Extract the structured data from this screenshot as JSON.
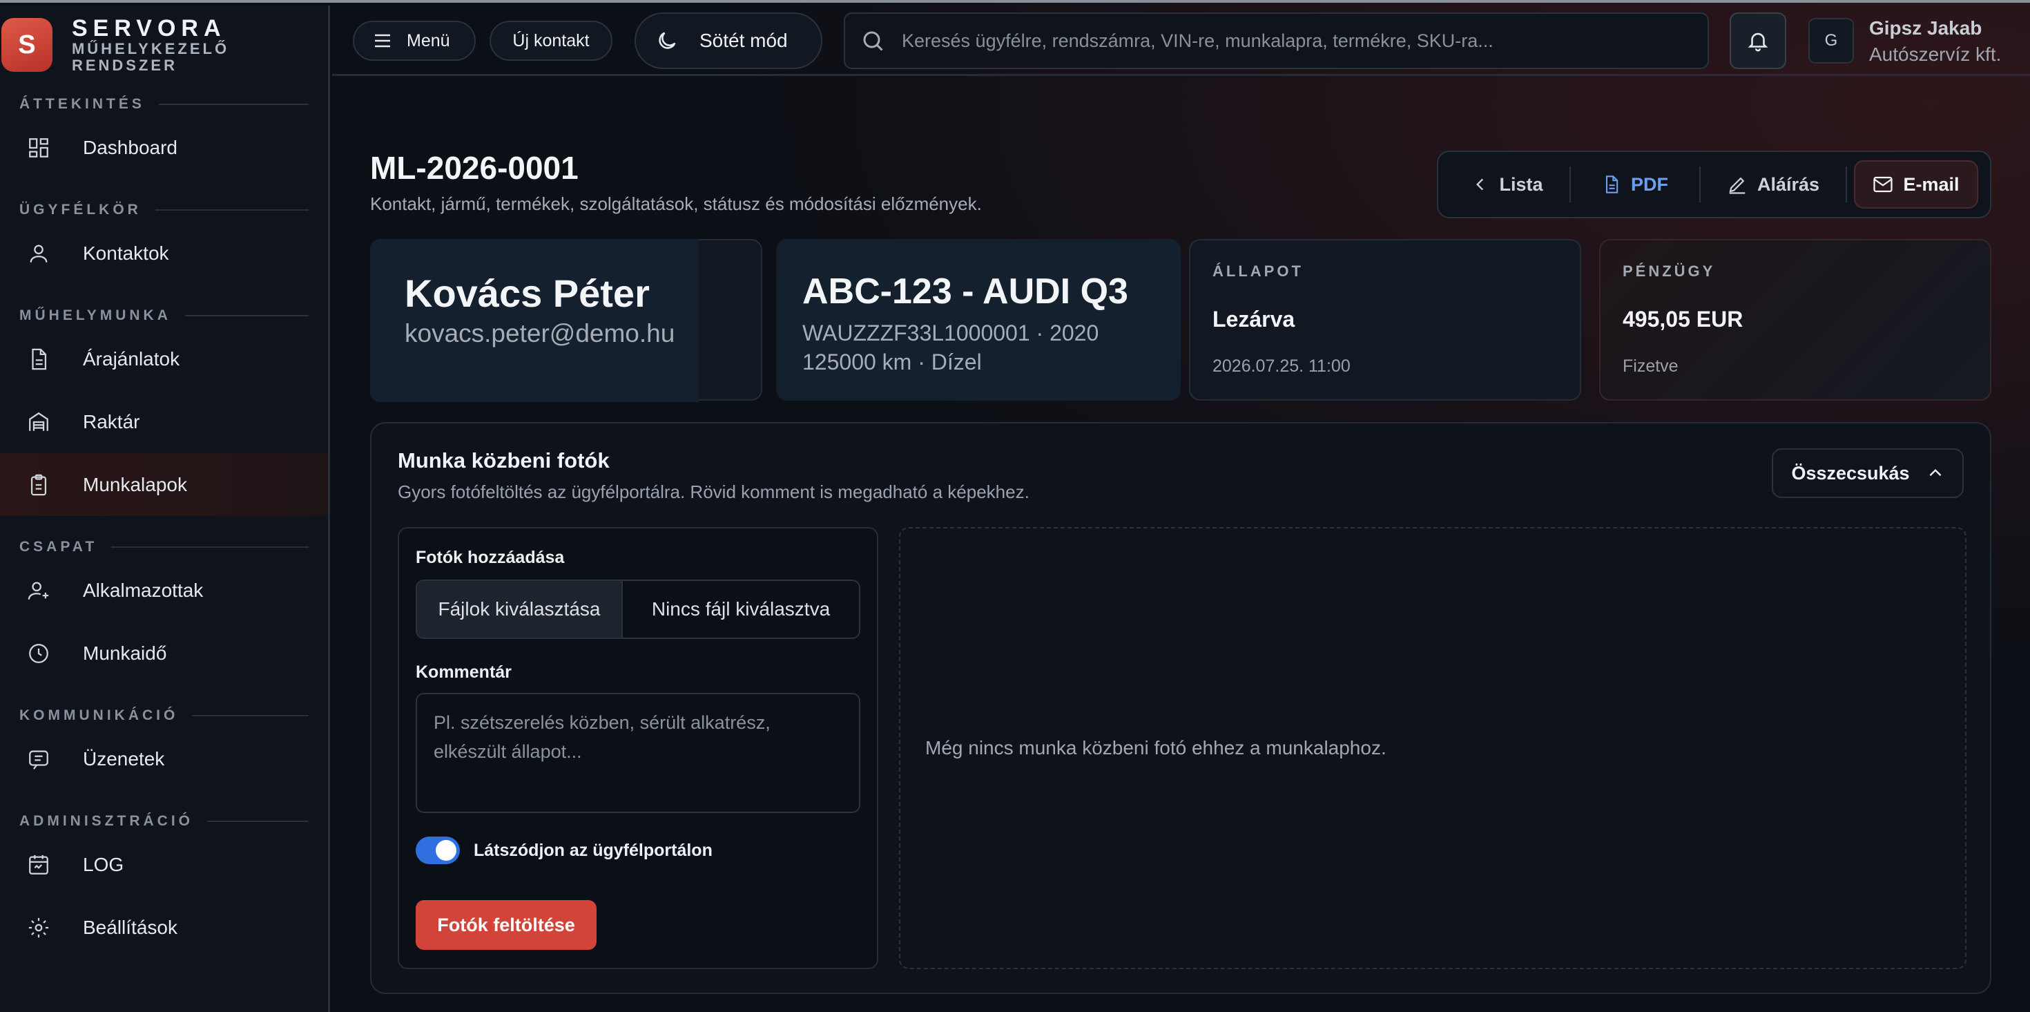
{
  "brand": {
    "logo_letter": "S",
    "name": "SERVORA",
    "subtitle": "MŰHELYKEZELŐ RENDSZER"
  },
  "sidebar": {
    "sections": [
      {
        "title": "ÁTTEKINTÉS",
        "items": [
          {
            "label": "Dashboard",
            "icon": "dashboard-icon"
          }
        ]
      },
      {
        "title": "ÜGYFÉLKÖR",
        "items": [
          {
            "label": "Kontaktok",
            "icon": "user-icon"
          }
        ]
      },
      {
        "title": "MŰHELYMUNKA",
        "items": [
          {
            "label": "Árajánlatok",
            "icon": "document-icon"
          },
          {
            "label": "Raktár",
            "icon": "warehouse-icon"
          },
          {
            "label": "Munkalapok",
            "icon": "clipboard-icon",
            "active": true
          }
        ]
      },
      {
        "title": "CSAPAT",
        "items": [
          {
            "label": "Alkalmazottak",
            "icon": "user-plus-icon"
          },
          {
            "label": "Munkaidő",
            "icon": "clock-icon"
          }
        ]
      },
      {
        "title": "KOMMUNIKÁCIÓ",
        "items": [
          {
            "label": "Üzenetek",
            "icon": "message-icon"
          }
        ]
      },
      {
        "title": "ADMINISZTRÁCIÓ",
        "items": [
          {
            "label": "LOG",
            "icon": "log-icon"
          },
          {
            "label": "Beállítások",
            "icon": "gear-icon"
          }
        ]
      }
    ]
  },
  "topbar": {
    "menu_label": "Menü",
    "new_contact_label": "Új kontakt",
    "dark_mode_label": "Sötét mód",
    "search_placeholder": "Keresés ügyfélre, rendszámra, VIN-re, munkalapra, termékre, SKU-ra...",
    "avatar_letter": "G",
    "user_name": "Gipsz Jakab",
    "company": "Autószervíz kft."
  },
  "page": {
    "title": "ML-2026-0001",
    "subtitle": "Kontakt, jármű, termékek, szolgáltatások, státusz és módosítási előzmények."
  },
  "actions": {
    "list": "Lista",
    "pdf": "PDF",
    "sign": "Aláírás",
    "email": "E-mail"
  },
  "cards": {
    "contact": {
      "name": "Kovács Péter",
      "email": "kovacs.peter@demo.hu"
    },
    "vehicle": {
      "plate_model": "ABC-123 - AUDI Q3",
      "vin_year": "WAUZZZF33L1000001 · 2020",
      "km_fuel": "125000 km · Dízel"
    },
    "status": {
      "label": "ÁLLAPOT",
      "value": "Lezárva",
      "date": "2026.07.25. 11:00"
    },
    "finance": {
      "label": "PÉNZÜGY",
      "value": "495,05 EUR",
      "state": "Fizetve"
    }
  },
  "photos": {
    "title": "Munka közbeni fotók",
    "subtitle": "Gyors fotófeltöltés az ügyfélportálra. Rövid komment is megadható a képekhez.",
    "collapse_label": "Összecsukás",
    "add_label": "Fotók hozzáadása",
    "file_button": "Fájlok kiválasztása",
    "file_status": "Nincs fájl kiválasztva",
    "comment_label": "Kommentár",
    "comment_placeholder": "Pl. szétszerelés közben, sérült alkatrész, elkészült állapot...",
    "portal_toggle_label": "Látszódjon az ügyfélportálon",
    "portal_toggle_on": true,
    "upload_label": "Fotók feltöltése",
    "empty_text": "Még nincs munka közbeni fotó ehhez a munkalaphoz."
  },
  "colors": {
    "accent": "#d2443a",
    "toggle": "#2f6fe0",
    "pdf": "#6aa0f0"
  }
}
